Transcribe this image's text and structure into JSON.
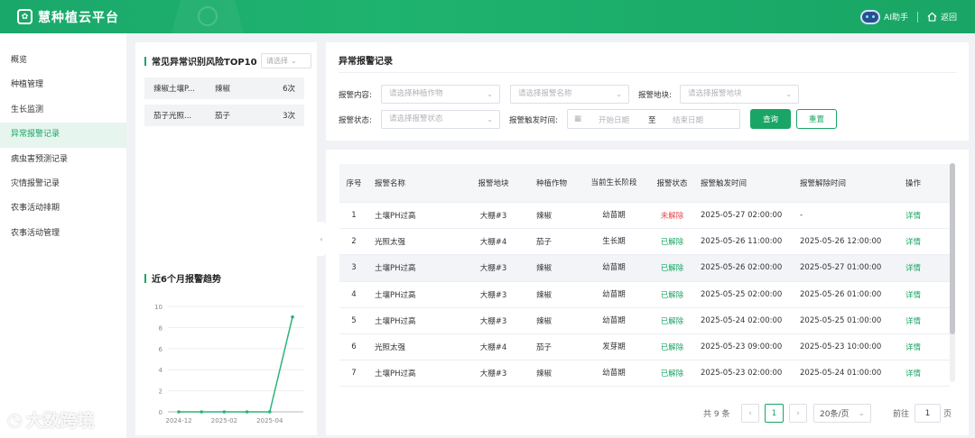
{
  "header": {
    "logo_icon": "leaf-badge-icon",
    "app_title": "慧种植云平台",
    "ai_label": "AI助手",
    "back_label": "返回"
  },
  "sidebar": {
    "items": [
      {
        "label": "概览",
        "active": false
      },
      {
        "label": "种植管理",
        "active": false
      },
      {
        "label": "生长监测",
        "active": false
      },
      {
        "label": "异常报警记录",
        "active": true
      },
      {
        "label": "病虫害预测记录",
        "active": false
      },
      {
        "label": "灾情报警记录",
        "active": false
      },
      {
        "label": "农事活动排期",
        "active": false
      },
      {
        "label": "农事活动管理",
        "active": false
      }
    ]
  },
  "top10": {
    "title": "常见异常识别风险TOP10",
    "select_placeholder": "请选择",
    "rows": [
      {
        "name": "辣椒土壤P...",
        "crop": "辣椒",
        "count": "6次"
      },
      {
        "name": "茄子光照...",
        "crop": "茄子",
        "count": "3次"
      }
    ]
  },
  "trend": {
    "title": "近6个月报警趋势"
  },
  "chart_data": {
    "type": "line",
    "x": [
      "2024-12",
      "2025-01",
      "2025-02",
      "2025-03",
      "2025-04",
      "2025-05"
    ],
    "x_tick_labels": [
      "2024-12",
      "2025-02",
      "2025-04"
    ],
    "series": [
      {
        "values": [
          0,
          0,
          0,
          0,
          0,
          9
        ]
      }
    ],
    "y_ticks": [
      "0",
      "2",
      "4",
      "6",
      "8",
      "10"
    ],
    "ylim": [
      0,
      10
    ],
    "grid": true,
    "color": "#2bb37a"
  },
  "filters": {
    "title": "异常报警记录",
    "content_label": "报警内容:",
    "crop_placeholder": "请选择种植作物",
    "name_placeholder": "请选择报警名称",
    "plot_label": "报警地块:",
    "plot_placeholder": "请选择报警地块",
    "status_label": "报警状态:",
    "status_placeholder": "请选择报警状态",
    "time_label": "报警触发时间:",
    "start_placeholder": "开始日期",
    "to_label": "至",
    "end_placeholder": "结束日期",
    "search_label": "查询",
    "reset_label": "重置"
  },
  "table": {
    "columns": [
      "序号",
      "报警名称",
      "报警地块",
      "种植作物",
      "当前生长阶段",
      "报警状态",
      "报警触发时间",
      "报警解除时间",
      "操作"
    ],
    "rows": [
      {
        "no": "1",
        "name": "土壤PH过高",
        "plot": "大棚#3",
        "crop": "辣椒",
        "stage": "幼苗期",
        "status": "未解除",
        "status_color": "#e5484d",
        "trigger": "2025-05-27 02:00:00",
        "release": "-",
        "action": "详情"
      },
      {
        "no": "2",
        "name": "光照太强",
        "plot": "大棚#4",
        "crop": "茄子",
        "stage": "生长期",
        "status": "已解除",
        "status_color": "#19a565",
        "trigger": "2025-05-26 11:00:00",
        "release": "2025-05-26 12:00:00",
        "action": "详情"
      },
      {
        "no": "3",
        "name": "土壤PH过高",
        "plot": "大棚#3",
        "crop": "辣椒",
        "stage": "幼苗期",
        "status": "已解除",
        "status_color": "#19a565",
        "trigger": "2025-05-26 02:00:00",
        "release": "2025-05-27 01:00:00",
        "action": "详情"
      },
      {
        "no": "4",
        "name": "土壤PH过高",
        "plot": "大棚#3",
        "crop": "辣椒",
        "stage": "幼苗期",
        "status": "已解除",
        "status_color": "#19a565",
        "trigger": "2025-05-25 02:00:00",
        "release": "2025-05-26 01:00:00",
        "action": "详情"
      },
      {
        "no": "5",
        "name": "土壤PH过高",
        "plot": "大棚#3",
        "crop": "辣椒",
        "stage": "幼苗期",
        "status": "已解除",
        "status_color": "#19a565",
        "trigger": "2025-05-24 02:00:00",
        "release": "2025-05-25 01:00:00",
        "action": "详情"
      },
      {
        "no": "6",
        "name": "光照太强",
        "plot": "大棚#4",
        "crop": "茄子",
        "stage": "发芽期",
        "status": "已解除",
        "status_color": "#19a565",
        "trigger": "2025-05-23 09:00:00",
        "release": "2025-05-23 10:00:00",
        "action": "详情"
      },
      {
        "no": "7",
        "name": "土壤PH过高",
        "plot": "大棚#3",
        "crop": "辣椒",
        "stage": "幼苗期",
        "status": "已解除",
        "status_color": "#19a565",
        "trigger": "2025-05-23 02:00:00",
        "release": "2025-05-24 01:00:00",
        "action": "详情"
      }
    ]
  },
  "pagination": {
    "total": "共 9 条",
    "current_page": "1",
    "page_size": "20条/页",
    "goto_prefix": "前往",
    "goto_value": "1",
    "goto_suffix": "页"
  },
  "watermark": {
    "brand": "大数跨境"
  }
}
